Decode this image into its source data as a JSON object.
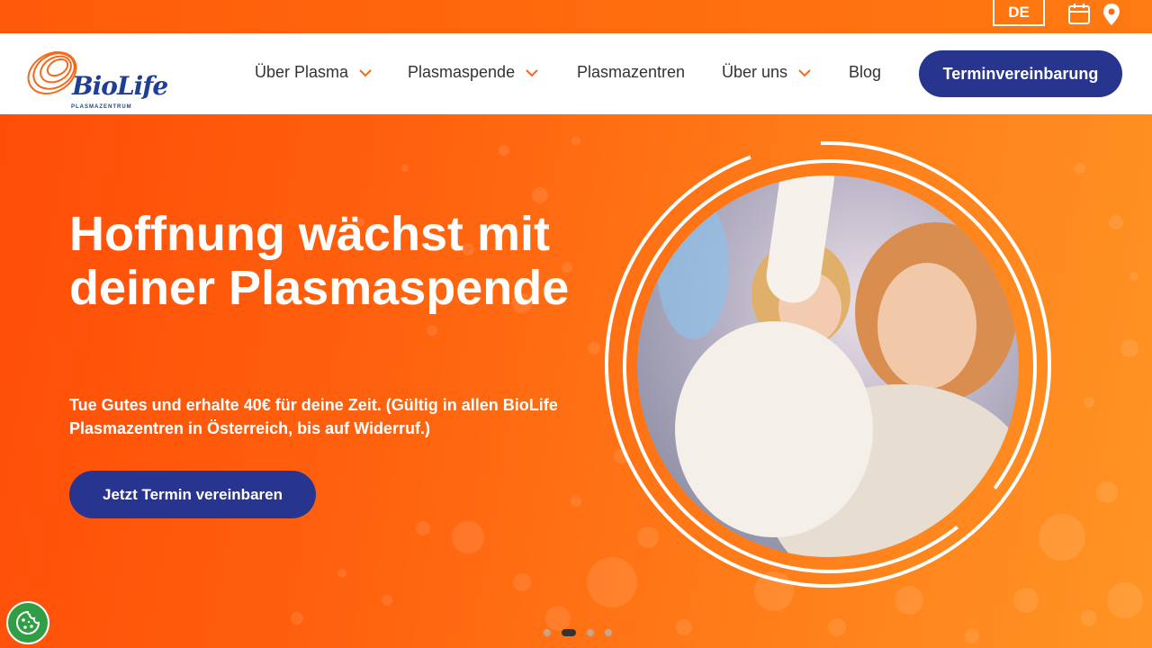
{
  "topbar": {
    "language": "DE",
    "icons": [
      "calendar-icon",
      "location-pin-icon"
    ]
  },
  "header": {
    "logo": {
      "name": "BioLife",
      "sub": "PLASMAZENTRUM"
    },
    "nav": [
      {
        "label": "Über Plasma",
        "has_dropdown": true
      },
      {
        "label": "Plasmaspende",
        "has_dropdown": true
      },
      {
        "label": "Plasmazentren",
        "has_dropdown": false
      },
      {
        "label": "Über uns",
        "has_dropdown": true
      },
      {
        "label": "Blog",
        "has_dropdown": false
      }
    ],
    "cta": "Terminvereinbarung"
  },
  "hero": {
    "headline": "Hoffnung wächst mit deiner Plasmaspende",
    "subtext": "Tue Gutes und erhalte 40€ für deine Zeit. (Gültig in allen BioLife Plasmazentren in Österreich, bis auf Widerruf.)",
    "cta": "Jetzt Termin vereinbaren",
    "slides": 4,
    "active_slide": 2
  },
  "colors": {
    "accent_orange": "#ff6a10",
    "brand_blue": "#27358f",
    "cookie_green": "#2f9e44"
  }
}
